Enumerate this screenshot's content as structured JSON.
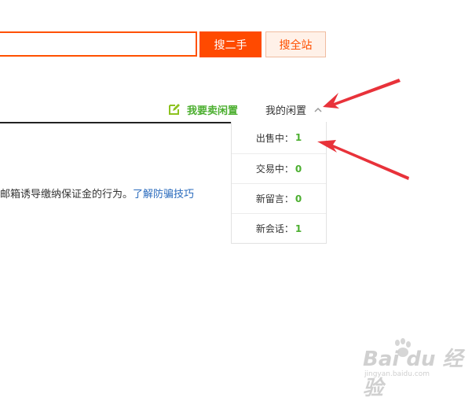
{
  "search": {
    "input_value": "",
    "primary_button": "搜二手",
    "secondary_button": "搜全站"
  },
  "nav": {
    "sell_label": "我要卖闲置",
    "my_label": "我的闲置",
    "collapse_icon": "chevron-up-icon"
  },
  "notice": {
    "text": "邮箱诱导缴纳保证金的行为。",
    "link_text": "了解防骗技巧"
  },
  "dropdown": {
    "items": [
      {
        "label": "出售中：",
        "count": "1"
      },
      {
        "label": "交易中：",
        "count": "0"
      },
      {
        "label": "新留言：",
        "count": "0"
      },
      {
        "label": "新会话：",
        "count": "1"
      }
    ]
  },
  "watermark": {
    "brand": "Bai du 经验",
    "url": "jingyan.baidu.com"
  },
  "colors": {
    "accent": "#ff4a00",
    "green": "#4caf30",
    "link": "#2a6bbd",
    "annotation": "#e8323a"
  }
}
